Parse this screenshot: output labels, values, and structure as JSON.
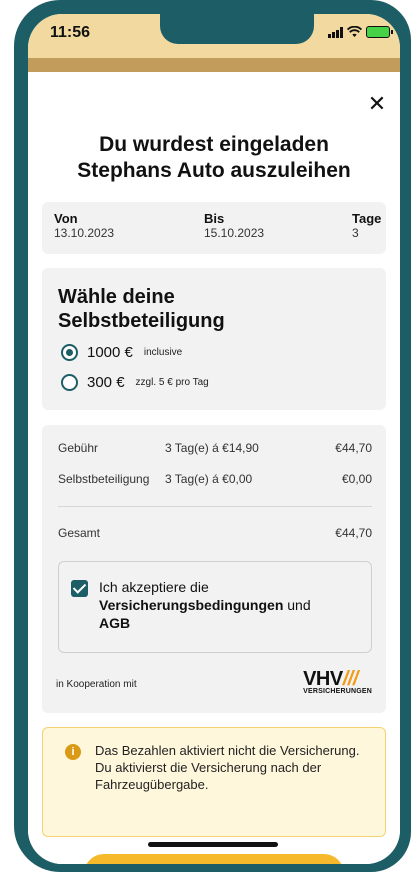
{
  "status": {
    "time": "11:56"
  },
  "title_line1": "Du wurdest eingeladen",
  "title_line2": "Stephans Auto auszuleihen",
  "dates": {
    "from_label": "Von",
    "from_value": "13.10.2023",
    "to_label": "Bis",
    "to_value": "15.10.2023",
    "days_label": "Tage",
    "days_value": "3"
  },
  "deductible": {
    "heading_line1": "Wähle deine",
    "heading_line2": "Selbstbeteiligung",
    "options": [
      {
        "amount": "1000 €",
        "note": "inclusive",
        "selected": true
      },
      {
        "amount": "300 €",
        "note": "zzgl. 5 € pro Tag",
        "selected": false
      }
    ]
  },
  "pricing": {
    "fee_label": "Gebühr",
    "fee_detail": "3 Tag(e) á €14,90",
    "fee_value": "€44,70",
    "deductible_label": "Selbstbeteiligung",
    "deductible_detail": "3 Tag(e) á €0,00",
    "deductible_value": "€0,00",
    "total_label": "Gesamt",
    "total_value": "€44,70"
  },
  "consent": {
    "checked": true,
    "text_prefix": "Ich akzeptiere die",
    "link_terms": "Versicherungsbedingungen",
    "text_and": " und",
    "link_agb": "AGB"
  },
  "cooperation": {
    "label": "in Kooperation mit",
    "partner_main": "VHV",
    "partner_slashes": "///",
    "partner_sub": "VERSICHERUNGEN"
  },
  "info": {
    "icon": "info-icon",
    "text": "Das Bezahlen aktiviert nicht die Versicherung. Du aktivierst die Versicherung nach der Fahrzeugübergabe."
  },
  "colors": {
    "primary": "#1d5e66",
    "accent": "#f6b92b",
    "info_bg": "#fff7dc"
  }
}
